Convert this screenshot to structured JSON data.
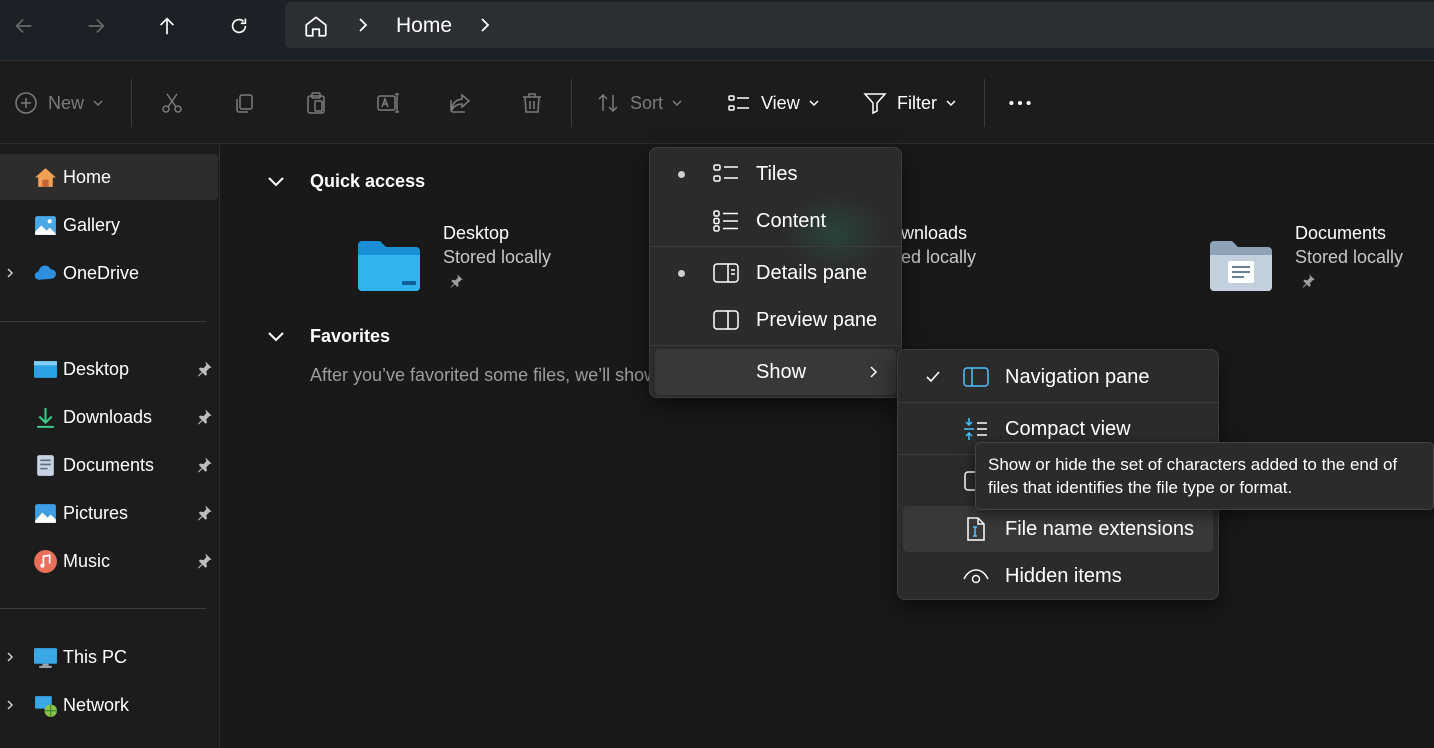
{
  "address_bar": {
    "breadcrumb": [
      "Home"
    ]
  },
  "toolbar": {
    "new_label": "New",
    "sort_label": "Sort",
    "view_label": "View",
    "filter_label": "Filter"
  },
  "sidebar": {
    "items": [
      {
        "label": "Home",
        "icon": "home-icon"
      },
      {
        "label": "Gallery",
        "icon": "gallery-icon"
      },
      {
        "label": "OneDrive",
        "icon": "onedrive-icon"
      },
      {
        "label": "Desktop",
        "icon": "desktop-icon"
      },
      {
        "label": "Downloads",
        "icon": "download-icon"
      },
      {
        "label": "Documents",
        "icon": "documents-icon"
      },
      {
        "label": "Pictures",
        "icon": "pictures-icon"
      },
      {
        "label": "Music",
        "icon": "music-icon"
      },
      {
        "label": "This PC",
        "icon": "this-pc-icon"
      },
      {
        "label": "Network",
        "icon": "network-icon"
      }
    ]
  },
  "main": {
    "quick_access_title": "Quick access",
    "quick_access_items": [
      {
        "name": "Desktop",
        "status": "Stored locally"
      },
      {
        "name": "wnloads",
        "status": "ed locally"
      },
      {
        "name": "Documents",
        "status": "Stored locally"
      }
    ],
    "favorites_title": "Favorites",
    "favorites_hint": "After you’ve favorited some files, we’ll show"
  },
  "view_menu": {
    "items": [
      {
        "label": "Tiles",
        "selected": true
      },
      {
        "label": "Content",
        "selected": false
      },
      {
        "label": "Details pane",
        "selected": true
      },
      {
        "label": "Preview pane",
        "selected": false
      },
      {
        "label": "Show",
        "has_submenu": true
      }
    ]
  },
  "show_menu": {
    "items": [
      {
        "label": "Navigation pane",
        "checked": true
      },
      {
        "label": "Compact view",
        "checked": false
      },
      {
        "label": "File name extensions",
        "checked": false
      },
      {
        "label": "Hidden items",
        "checked": false
      }
    ]
  },
  "tooltip": {
    "text": "Show or hide the set of characters added to the end of files that identifies the file type or format."
  },
  "colors": {
    "folder_blue": "#2fa9e8",
    "accent": "#4cc2ff"
  }
}
